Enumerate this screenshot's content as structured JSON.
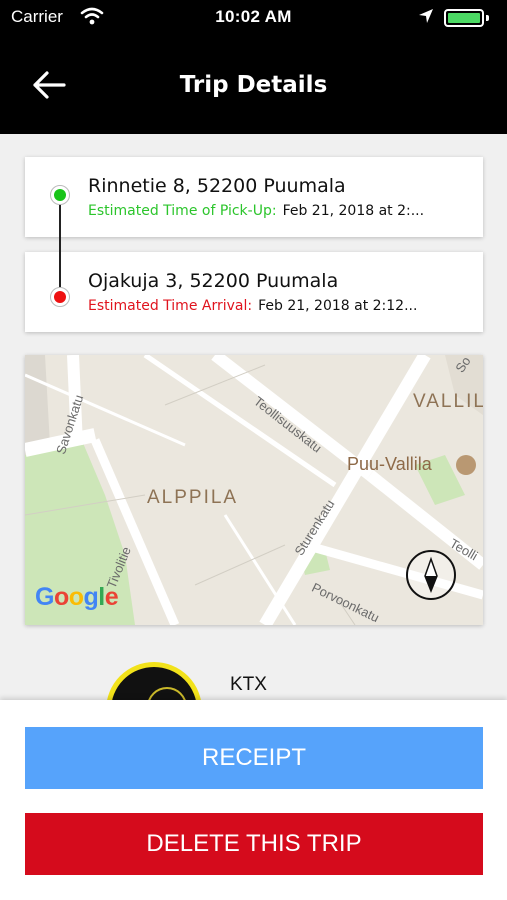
{
  "status_bar": {
    "carrier": "Carrier",
    "time": "10:02 AM",
    "icons": [
      "wifi-icon",
      "location-arrow-icon",
      "battery-icon"
    ],
    "battery_color": "#4cd964"
  },
  "nav": {
    "title": "Trip Details",
    "back_icon": "arrow-left-icon"
  },
  "pickup": {
    "address": "Rinnetie 8, 52200 Puumala",
    "eta_label": "Estimated Time of Pick-Up:",
    "eta_value": "Feb 21, 2018 at 2:...",
    "color": "#19c419"
  },
  "dropoff": {
    "address": "Ojakuja 3, 52200 Puumala",
    "eta_label": "Estimated Time Arrival:",
    "eta_value": "Feb 21, 2018 at 2:12...",
    "color": "#ee1111"
  },
  "map": {
    "streets": [
      "Savonkatu",
      "Teollisuuskatu",
      "Tivolitie",
      "Sturenkatu",
      "Porvoonkatu",
      "Teolli",
      "So"
    ],
    "districts": [
      "ALPPILA",
      "VALLIL"
    ],
    "poi": "Puu-Vallila",
    "provider": "Google",
    "compass_icon": "compass-icon"
  },
  "driver": {
    "name": "KTX"
  },
  "actions": {
    "receipt": "RECEIPT",
    "delete": "DELETE THIS TRIP",
    "receipt_color": "#56a3fb",
    "delete_color": "#d50b1c"
  }
}
